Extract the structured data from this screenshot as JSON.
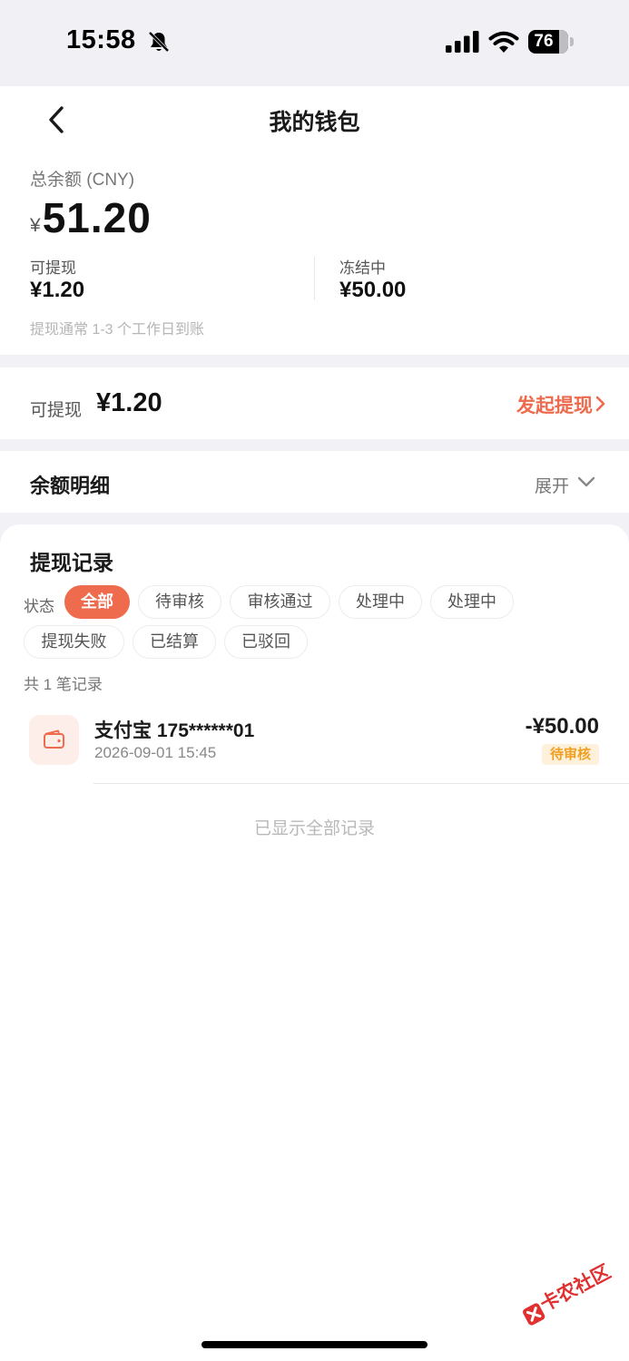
{
  "status_bar": {
    "time": "15:58",
    "battery_level": "76",
    "icons": [
      "bell-off-icon",
      "signal-icon",
      "wifi-icon",
      "battery-icon"
    ]
  },
  "header": {
    "title": "我的钱包",
    "back_icon": "back-icon"
  },
  "balance": {
    "total_label": "总余额 (CNY)",
    "currency_symbol": "¥",
    "total_value": "51.20",
    "available_label": "可提现",
    "available_value": "¥1.20",
    "frozen_label": "冻结中",
    "frozen_value": "¥50.00",
    "note": "提现通常 1-3 个工作日到账"
  },
  "withdraw": {
    "label": "可提现",
    "value": "¥1.20",
    "action_label": "发起提现",
    "accent_color": "#ee6a4c"
  },
  "balance_detail": {
    "title": "余额明细",
    "expand_label": "展开"
  },
  "records": {
    "title": "提现记录",
    "status_label": "状态",
    "filters": [
      {
        "label": "全部",
        "active": true
      },
      {
        "label": "待审核",
        "active": false
      },
      {
        "label": "审核通过",
        "active": false
      },
      {
        "label": "处理中",
        "active": false
      },
      {
        "label": "处理中",
        "active": false
      },
      {
        "label": "提现失败",
        "active": false
      },
      {
        "label": "已结算",
        "active": false
      },
      {
        "label": "已驳回",
        "active": false
      }
    ],
    "count_text": "共 1 笔记录",
    "items": [
      {
        "name": "支付宝 175******01",
        "time": "2026-09-01 15:45",
        "amount": "-¥50.00",
        "status": "待审核",
        "icon": "wallet-icon"
      }
    ],
    "end_note": "已显示全部记录"
  },
  "watermark": {
    "text": "卡农社区"
  }
}
